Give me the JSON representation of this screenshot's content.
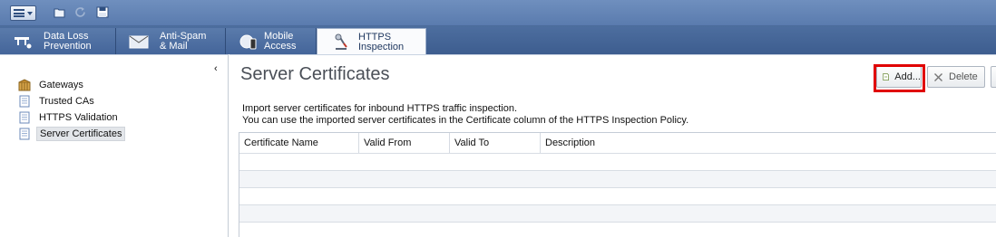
{
  "toolbar": {
    "menu_icon": "menu-icon",
    "icons": [
      "open-folder-icon",
      "refresh-icon",
      "save-icon"
    ]
  },
  "tabs": [
    {
      "label": "Data Loss\nPrevention",
      "icon": "dlp-icon"
    },
    {
      "label": "Anti-Spam\n& Mail",
      "icon": "mail-icon"
    },
    {
      "label": "Mobile\nAccess",
      "icon": "mobile-access-icon"
    },
    {
      "label": "HTTPS\nInspection",
      "icon": "https-inspection-icon",
      "active": true
    }
  ],
  "sidebar": {
    "collapse_glyph": "‹",
    "items": [
      {
        "label": "Gateways",
        "icon": "gateway-icon"
      },
      {
        "label": "Trusted CAs",
        "icon": "document-icon"
      },
      {
        "label": "HTTPS Validation",
        "icon": "document-icon"
      },
      {
        "label": "Server Certificates",
        "icon": "document-icon",
        "selected": true
      }
    ]
  },
  "main": {
    "title": "Server Certificates",
    "add_label": "Add...",
    "delete_label": "Delete",
    "description_line1": "Import server certificates for inbound HTTPS traffic inspection.",
    "description_line2": "You can use the imported server certificates in the Certificate column of the HTTPS Inspection Policy.",
    "columns": [
      "Certificate Name",
      "Valid From",
      "Valid To",
      "Description"
    ],
    "rows": []
  },
  "colors": {
    "tab_bar": "#4d6e9f",
    "highlight": "#e00000"
  }
}
